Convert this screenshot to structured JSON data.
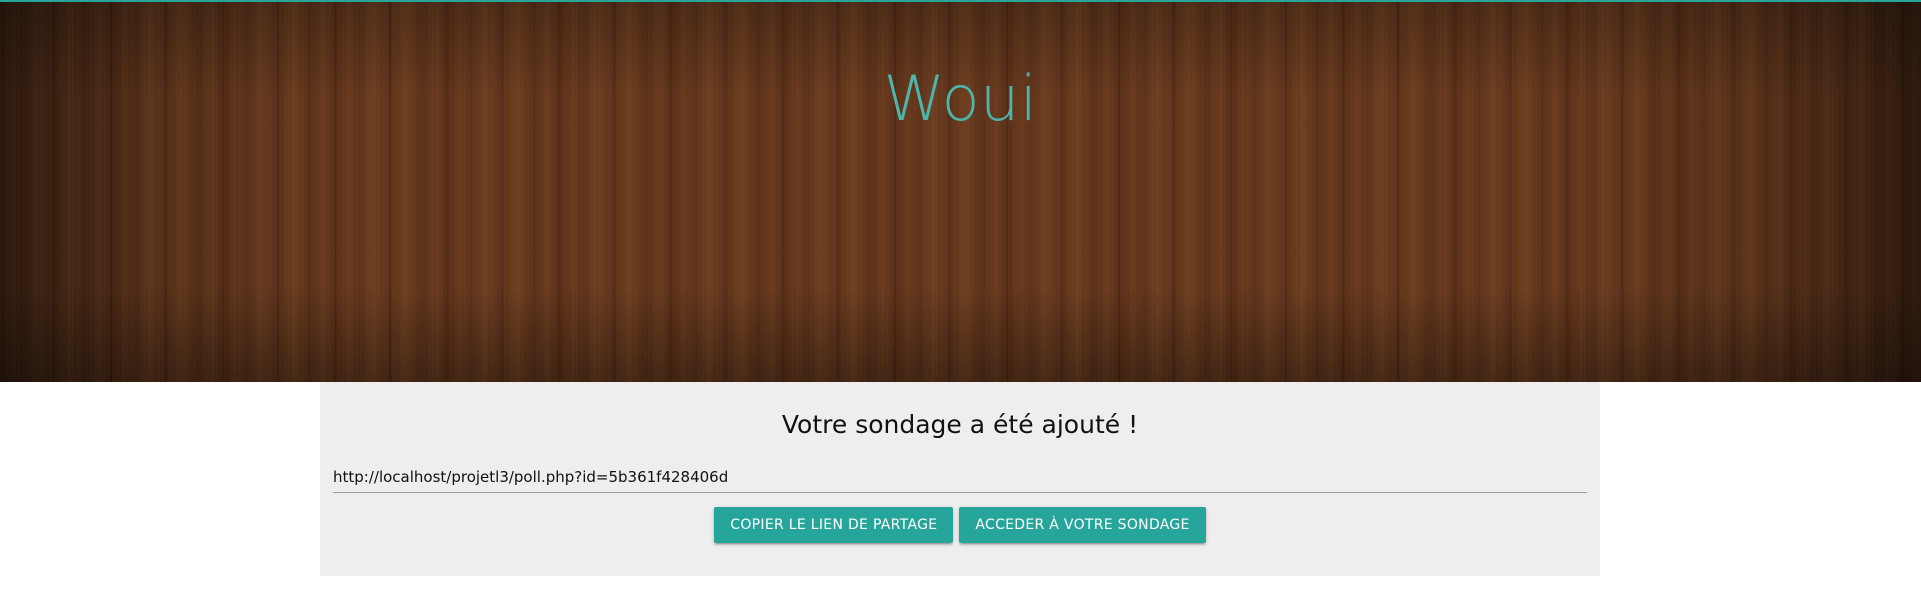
{
  "hero": {
    "title": "Woui"
  },
  "card": {
    "heading": "Votre sondage a été ajouté !",
    "share_link": "http://localhost/projetl3/poll.php?id=5b361f428406d",
    "buttons": {
      "copy_label": "COPIER LE LIEN DE PARTAGE",
      "access_label": "ACCEDER À VOTRE SONDAGE"
    }
  },
  "colors": {
    "accent": "#26a69a",
    "title": "#4db6ac",
    "card_background": "#eeeeee"
  }
}
